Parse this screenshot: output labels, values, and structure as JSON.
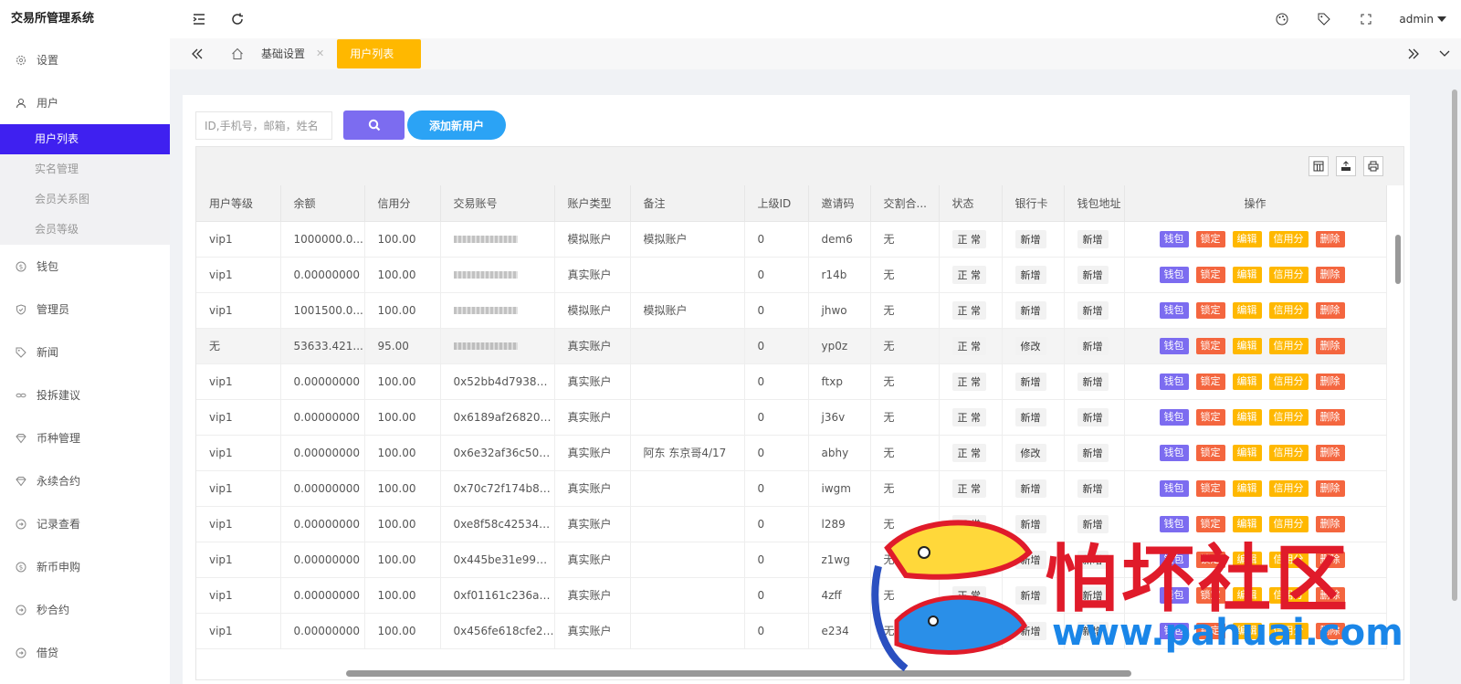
{
  "app": {
    "title": "交易所管理系统"
  },
  "topbar": {
    "user": "admin"
  },
  "sidebar": {
    "items": [
      {
        "label": "设置",
        "icon": "gear-icon"
      },
      {
        "label": "用户",
        "icon": "user-icon"
      },
      {
        "label": "钱包",
        "icon": "dollar-icon"
      },
      {
        "label": "管理员",
        "icon": "shield-icon"
      },
      {
        "label": "新闻",
        "icon": "tag-icon"
      },
      {
        "label": "投拆建议",
        "icon": "link-icon"
      },
      {
        "label": "币种管理",
        "icon": "diamond-icon"
      },
      {
        "label": "永续合约",
        "icon": "diamond-icon"
      },
      {
        "label": "记录查看",
        "icon": "circle-arrow-icon"
      },
      {
        "label": "新币申购",
        "icon": "dollar-icon"
      },
      {
        "label": "秒合约",
        "icon": "circle-arrow-icon"
      },
      {
        "label": "借贷",
        "icon": "circle-arrow-icon"
      }
    ],
    "submenu": [
      "用户列表",
      "实名管理",
      "会员关系图",
      "会员等级"
    ]
  },
  "tabs": {
    "home": "home",
    "basic": "基础设置",
    "active": "用户列表"
  },
  "search": {
    "placeholder": "ID,手机号，邮箱，姓名",
    "add_label": "添加新用户"
  },
  "table": {
    "columns": [
      "用户等级",
      "余额",
      "信用分",
      "交易账号",
      "账户类型",
      "备注",
      "上级ID",
      "邀请码",
      "交割合...",
      "状态",
      "银行卡",
      "钱包地址",
      "操作"
    ],
    "rows": [
      {
        "level": "vip1",
        "balance": "1000000.0...",
        "credit": "100.00",
        "account": "",
        "type": "模拟账户",
        "note": "模拟账户",
        "parent": "0",
        "code": "dem6",
        "delivery": "无",
        "status": "正 常",
        "bank": "新增",
        "wallet": "新增"
      },
      {
        "level": "vip1",
        "balance": "0.00000000",
        "credit": "100.00",
        "account": "",
        "type": "真实账户",
        "note": "",
        "parent": "0",
        "code": "r14b",
        "delivery": "无",
        "status": "正 常",
        "bank": "新增",
        "wallet": "新增"
      },
      {
        "level": "vip1",
        "balance": "1001500.0...",
        "credit": "100.00",
        "account": "",
        "type": "模拟账户",
        "note": "模拟账户",
        "parent": "0",
        "code": "jhwo",
        "delivery": "无",
        "status": "正 常",
        "bank": "新增",
        "wallet": "新增"
      },
      {
        "level": "无",
        "balance": "53633.421...",
        "credit": "95.00",
        "account": "",
        "type": "真实账户",
        "note": "",
        "parent": "0",
        "code": "yp0z",
        "delivery": "无",
        "status": "正 常",
        "bank": "修改",
        "wallet": "新增"
      },
      {
        "level": "vip1",
        "balance": "0.00000000",
        "credit": "100.00",
        "account": "0x52bb4d793803...",
        "type": "真实账户",
        "note": "",
        "parent": "0",
        "code": "ftxp",
        "delivery": "无",
        "status": "正 常",
        "bank": "新增",
        "wallet": "新增"
      },
      {
        "level": "vip1",
        "balance": "0.00000000",
        "credit": "100.00",
        "account": "0x6189af26820e5...",
        "type": "真实账户",
        "note": "",
        "parent": "0",
        "code": "j36v",
        "delivery": "无",
        "status": "正 常",
        "bank": "新增",
        "wallet": "新增"
      },
      {
        "level": "vip1",
        "balance": "0.00000000",
        "credit": "100.00",
        "account": "0x6e32af36c50e9...",
        "type": "真实账户",
        "note": "阿东 东京哥4/17",
        "parent": "0",
        "code": "abhy",
        "delivery": "无",
        "status": "正 常",
        "bank": "修改",
        "wallet": "新增"
      },
      {
        "level": "vip1",
        "balance": "0.00000000",
        "credit": "100.00",
        "account": "0x70c72f174b8cf3...",
        "type": "真实账户",
        "note": "",
        "parent": "0",
        "code": "iwgm",
        "delivery": "无",
        "status": "正 常",
        "bank": "新增",
        "wallet": "新增"
      },
      {
        "level": "vip1",
        "balance": "0.00000000",
        "credit": "100.00",
        "account": "0xe8f58c4253499...",
        "type": "真实账户",
        "note": "",
        "parent": "0",
        "code": "l289",
        "delivery": "无",
        "status": "正 常",
        "bank": "新增",
        "wallet": "新增"
      },
      {
        "level": "vip1",
        "balance": "0.00000000",
        "credit": "100.00",
        "account": "0x445be31e9981...",
        "type": "真实账户",
        "note": "",
        "parent": "0",
        "code": "z1wg",
        "delivery": "无",
        "status": "正 常",
        "bank": "新增",
        "wallet": "新增"
      },
      {
        "level": "vip1",
        "balance": "0.00000000",
        "credit": "100.00",
        "account": "0xf01161c236a09...",
        "type": "真实账户",
        "note": "",
        "parent": "0",
        "code": "4zff",
        "delivery": "无",
        "status": "正 常",
        "bank": "新增",
        "wallet": "新增"
      },
      {
        "level": "vip1",
        "balance": "0.00000000",
        "credit": "100.00",
        "account": "0x456fe618cfe261...",
        "type": "真实账户",
        "note": "",
        "parent": "0",
        "code": "e234",
        "delivery": "无",
        "status": "正 常",
        "bank": "新增",
        "wallet": "新增"
      }
    ],
    "actions": [
      "钱包",
      "锁定",
      "编辑",
      "信用分",
      "删除"
    ]
  },
  "watermark": {
    "title": "怕坏社区",
    "url": "www.pahuai.com"
  },
  "colors": {
    "accent": "#3f20f0",
    "tab_active": "#ffb800",
    "search_btn": "#7c6cf0",
    "add_btn": "#2ba3f5"
  }
}
